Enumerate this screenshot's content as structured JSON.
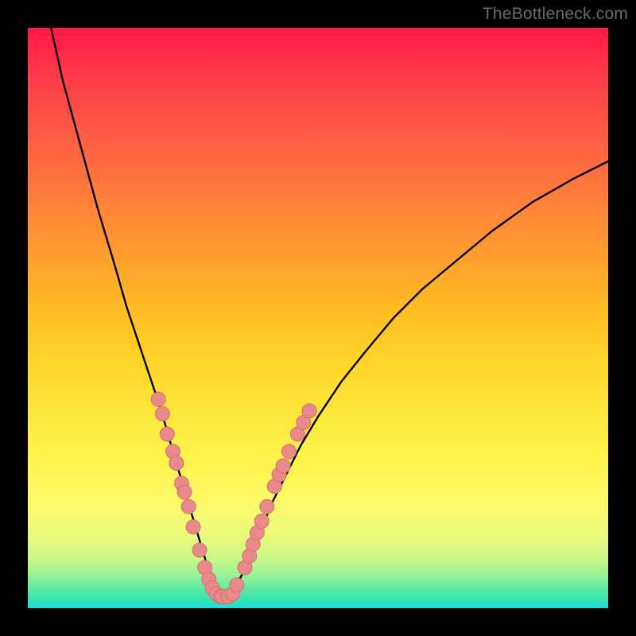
{
  "watermark": "TheBottleneck.com",
  "colors": {
    "frame": "#000000",
    "curve": "#000000",
    "marker_fill": "#e88a8a",
    "marker_stroke": "#d86f6f"
  },
  "chart_data": {
    "type": "line",
    "title": "",
    "xlabel": "",
    "ylabel": "",
    "xlim": [
      0,
      100
    ],
    "ylim": [
      0,
      100
    ],
    "grid": false,
    "legend": false,
    "series": [
      {
        "name": "bottleneck-curve",
        "x": [
          4,
          6,
          9,
          12,
          15,
          17,
          19,
          21,
          23,
          25,
          26.5,
          28,
          29.5,
          31,
          32,
          33,
          34.5,
          36,
          38,
          40,
          42,
          44,
          47,
          50,
          54,
          58,
          63,
          68,
          74,
          80,
          87,
          94,
          100
        ],
        "y": [
          100,
          91,
          80,
          69,
          59,
          52,
          46,
          40,
          34,
          27,
          22,
          17,
          12,
          7,
          4,
          2,
          2,
          4,
          8,
          13,
          18,
          22,
          28,
          33,
          39,
          44,
          50,
          55,
          60,
          65,
          70,
          74,
          77
        ]
      }
    ],
    "markers": [
      {
        "x": 22.5,
        "y": 36
      },
      {
        "x": 23.2,
        "y": 33.5
      },
      {
        "x": 24.0,
        "y": 30
      },
      {
        "x": 25.0,
        "y": 27
      },
      {
        "x": 25.6,
        "y": 25
      },
      {
        "x": 26.5,
        "y": 21.5
      },
      {
        "x": 27.0,
        "y": 20
      },
      {
        "x": 27.7,
        "y": 17.5
      },
      {
        "x": 28.5,
        "y": 14
      },
      {
        "x": 29.6,
        "y": 10
      },
      {
        "x": 30.5,
        "y": 7
      },
      {
        "x": 31.2,
        "y": 5
      },
      {
        "x": 31.8,
        "y": 3.5
      },
      {
        "x": 32.5,
        "y": 2.5
      },
      {
        "x": 33.2,
        "y": 2
      },
      {
        "x": 33.5,
        "y": 2
      },
      {
        "x": 34.5,
        "y": 2
      },
      {
        "x": 35.3,
        "y": 2.5
      },
      {
        "x": 36.0,
        "y": 4
      },
      {
        "x": 37.4,
        "y": 7
      },
      {
        "x": 38.2,
        "y": 9
      },
      {
        "x": 38.8,
        "y": 11
      },
      {
        "x": 39.5,
        "y": 13
      },
      {
        "x": 40.3,
        "y": 15
      },
      {
        "x": 41.2,
        "y": 17.5
      },
      {
        "x": 42.5,
        "y": 21
      },
      {
        "x": 43.3,
        "y": 23
      },
      {
        "x": 44.0,
        "y": 24.5
      },
      {
        "x": 45.0,
        "y": 27
      },
      {
        "x": 46.5,
        "y": 30
      },
      {
        "x": 47.5,
        "y": 32
      },
      {
        "x": 48.5,
        "y": 34
      }
    ]
  }
}
